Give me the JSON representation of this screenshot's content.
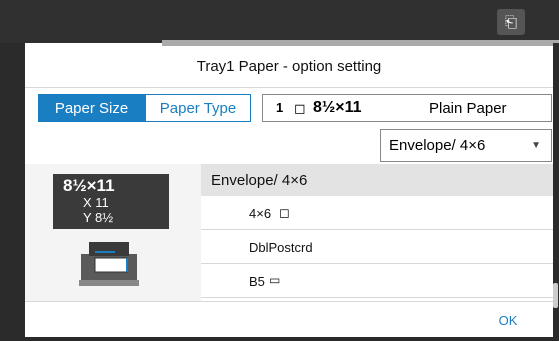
{
  "header": {
    "status_icon": "job-status-icon"
  },
  "dialog": {
    "title": "Tray1 Paper - option setting",
    "buttons": {
      "paper_size": "Paper Size",
      "paper_type": "Paper Type",
      "ok": "OK"
    },
    "summary": {
      "tray_number": "1",
      "orientation_icon": "landscape-paper-icon",
      "size": "8½×11",
      "paper_type": "Plain Paper"
    },
    "dropdown": {
      "selected": "Envelope/ 4×6"
    },
    "preview": {
      "size": "8½×11",
      "x_label": "X 11",
      "y_label": "Y 8½"
    },
    "list": {
      "header": "Envelope/ 4×6",
      "items": [
        {
          "label": "4×6",
          "icon": "landscape-paper-icon"
        },
        {
          "label": "DblPostcrd",
          "icon": ""
        },
        {
          "label": "B5",
          "icon": "portrait-paper-icon"
        }
      ]
    }
  },
  "colors": {
    "accent": "#1a7ec2",
    "bar": "#303030"
  }
}
